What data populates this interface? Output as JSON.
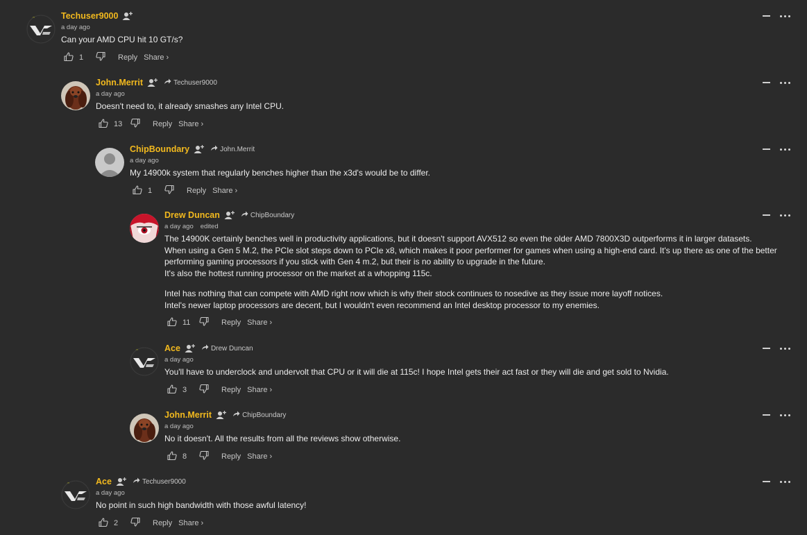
{
  "comments": [
    {
      "author": "Techuser9000",
      "reply_to": "",
      "time": "a day ago",
      "edited": "",
      "avatar": "logo",
      "paragraphs": [
        "Can your AMD CPU hit 10 GT/s?"
      ],
      "likes": "1",
      "reply_label": "Reply",
      "share_label": "Share ›"
    },
    {
      "author": "John.Merrit",
      "reply_to": "Techuser9000",
      "time": "a day ago",
      "edited": "",
      "avatar": "dog",
      "paragraphs": [
        "Doesn't need to, it already smashes any Intel CPU."
      ],
      "likes": "13",
      "reply_label": "Reply",
      "share_label": "Share ›"
    },
    {
      "author": "ChipBoundary",
      "reply_to": "John.Merrit",
      "time": "a day ago",
      "edited": "",
      "avatar": "default",
      "paragraphs": [
        "My 14900k system that regularly benches higher than the x3d's would be to differ."
      ],
      "likes": "1",
      "reply_label": "Reply",
      "share_label": "Share ›"
    },
    {
      "author": "Drew Duncan",
      "reply_to": "ChipBoundary",
      "time": "a day ago",
      "edited": "edited",
      "avatar": "anime",
      "paragraphs": [
        "The 14900K certainly benches well in productivity applications, but it doesn't support AVX512 so even the older AMD 7800X3D outperforms it in larger datasets.",
        "When using a Gen 5 M.2, the PCIe slot steps down to PCIe x8, which makes it poor performer for games when using a high-end card. It's up there as one of the better performing gaming processors if you stick with Gen 4 m.2, but their is no ability to upgrade in the future.",
        "It's also the hottest running processor on the market at a whopping 115c.",
        "Intel has nothing that can compete with AMD right now which is why their stock continues to nosedive as they issue more layoff notices.",
        "Intel's newer laptop processors are decent, but I wouldn't even recommend an Intel desktop processor to my enemies."
      ],
      "likes": "11",
      "reply_label": "Reply",
      "share_label": "Share ›"
    },
    {
      "author": "Ace",
      "reply_to": "Drew Duncan",
      "time": "a day ago",
      "edited": "",
      "avatar": "logo",
      "paragraphs": [
        "You'll have to underclock and undervolt that CPU or it will die at 115c! I hope Intel gets their act fast or they will die and get sold to Nvidia."
      ],
      "likes": "3",
      "reply_label": "Reply",
      "share_label": "Share ›"
    },
    {
      "author": "John.Merrit",
      "reply_to": "ChipBoundary",
      "time": "a day ago",
      "edited": "",
      "avatar": "dog",
      "paragraphs": [
        "No it doesn't. All the results from all the reviews show otherwise."
      ],
      "likes": "8",
      "reply_label": "Reply",
      "share_label": "Share ›"
    },
    {
      "author": "Ace",
      "reply_to": "Techuser9000",
      "time": "a day ago",
      "edited": "",
      "avatar": "logo",
      "paragraphs": [
        "No point in such high bandwidth with those awful latency!"
      ],
      "likes": "2",
      "reply_label": "Reply",
      "share_label": "Share ›"
    }
  ],
  "colors": {
    "background": "#2b2b2b",
    "author": "#f2b91e",
    "text": "#ececec",
    "muted": "#bdbdbd"
  },
  "icons": {
    "follow": "user-plus-icon",
    "reply_arrow": "reply-arrow-icon",
    "like": "thumbs-up-icon",
    "dislike": "thumbs-down-icon",
    "minimize": "minimize-icon",
    "more": "more-options-icon"
  }
}
